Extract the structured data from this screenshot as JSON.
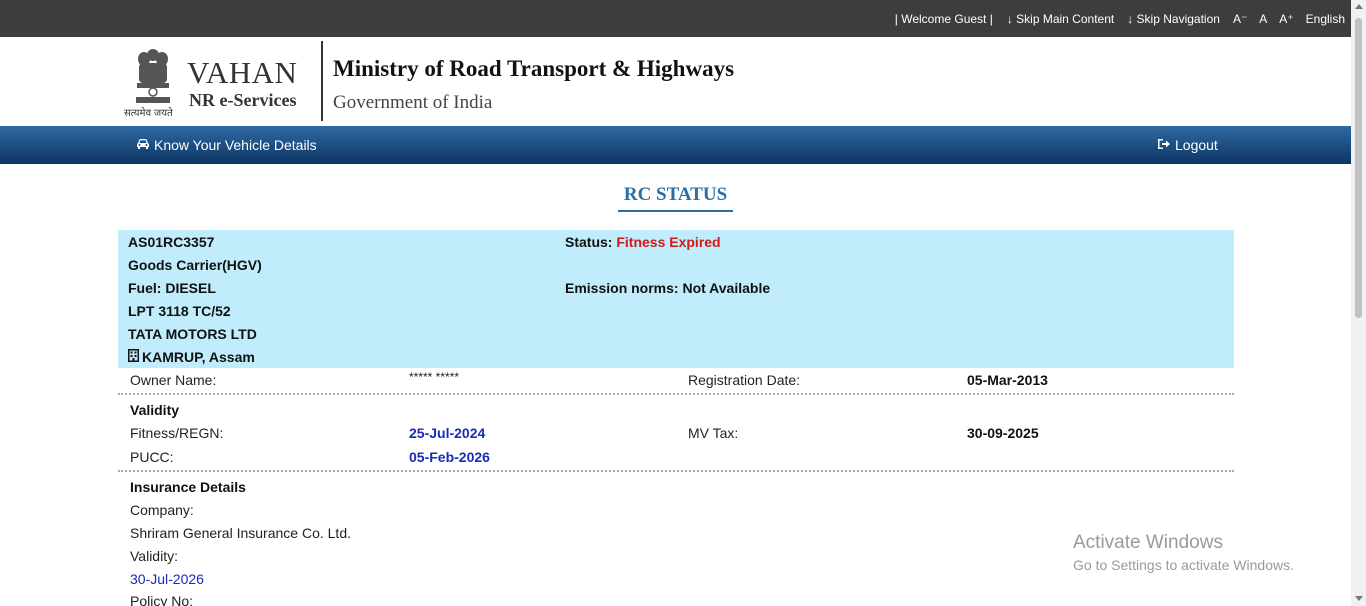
{
  "topbar": {
    "welcome": "| Welcome Guest |",
    "skip_main": "↓ Skip Main Content",
    "skip_nav": "↓ Skip Navigation",
    "font_decrease": "A⁻",
    "font_normal": "A",
    "font_increase": "A⁺",
    "language": "English"
  },
  "header": {
    "brand": "VAHAN",
    "sub_brand": "NR e-Services",
    "emblem_caption": "सत्यमेव जयते",
    "ministry": "Ministry of Road Transport & Highways",
    "government": "Government of India"
  },
  "nav": {
    "know_vehicle": "Know Your Vehicle Details",
    "logout": "Logout"
  },
  "page_title": "RC STATUS",
  "vehicle": {
    "reg_no": "AS01RC3357",
    "status_label": "Status:",
    "status_value": "Fitness Expired",
    "class": "Goods Carrier(HGV)",
    "fuel": "Fuel: DIESEL",
    "emission": "Emission norms: Not Available",
    "model": "LPT 3118 TC/52",
    "maker": "TATA MOTORS LTD",
    "rto": "KAMRUP, Assam"
  },
  "owner": {
    "label": "Owner Name:",
    "value": "***** *****",
    "reg_date_label": "Registration Date:",
    "reg_date_value": "05-Mar-2013"
  },
  "validity": {
    "heading": "Validity",
    "fitness_label": "Fitness/REGN:",
    "fitness_value": "25-Jul-2024",
    "mvtax_label": "MV Tax:",
    "mvtax_value": "30-09-2025",
    "pucc_label": "PUCC:",
    "pucc_value": "05-Feb-2026"
  },
  "insurance": {
    "heading": "Insurance Details",
    "company_label": "Company:",
    "company_value": "Shriram General Insurance Co. Ltd.",
    "validity_label": "Validity:",
    "validity_value": "30-Jul-2026",
    "policy_label": "Policy No:"
  },
  "watermark": {
    "line1": "Activate Windows",
    "line2": "Go to Settings to activate Windows."
  }
}
